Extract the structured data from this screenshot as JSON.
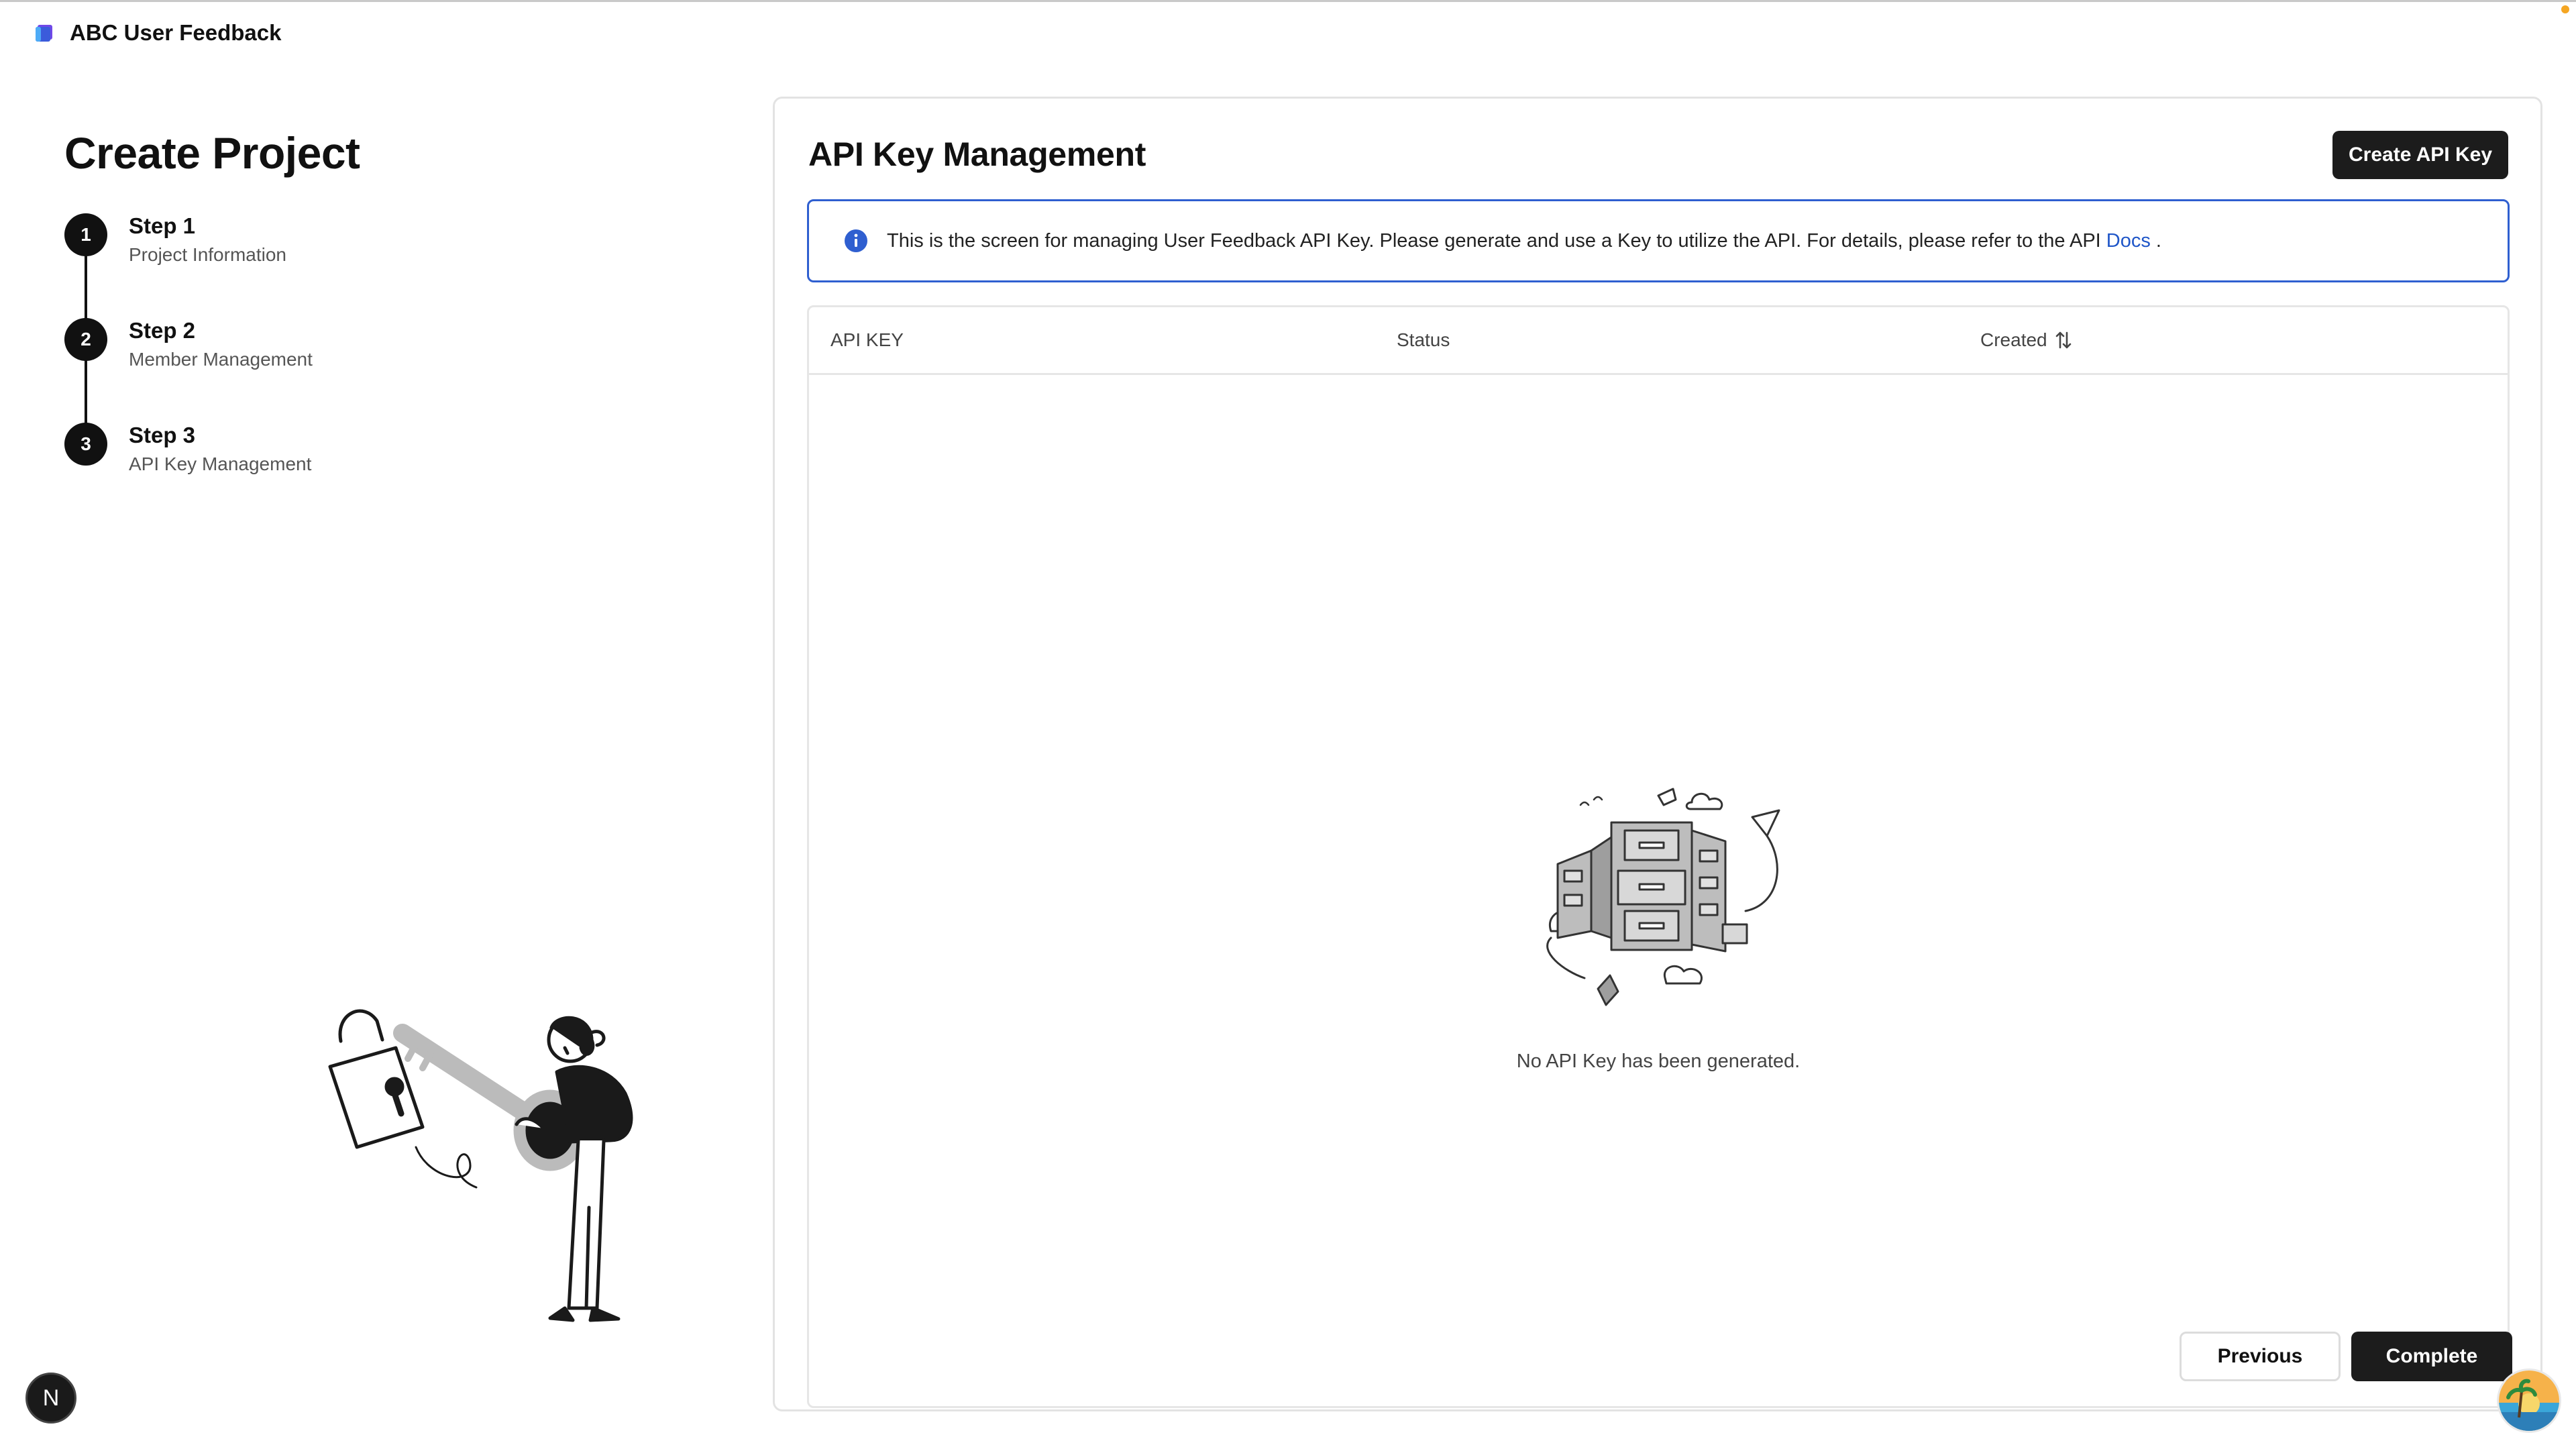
{
  "app": {
    "title": "ABC User Feedback"
  },
  "sidebar": {
    "page_title": "Create Project",
    "steps": [
      {
        "number": "1",
        "title": "Step 1",
        "subtitle": "Project Information"
      },
      {
        "number": "2",
        "title": "Step 2",
        "subtitle": "Member Management"
      },
      {
        "number": "3",
        "title": "Step 3",
        "subtitle": "API Key Management"
      }
    ]
  },
  "main": {
    "title": "API Key Management",
    "create_button": "Create API Key",
    "info": {
      "text": "This is the screen for managing User Feedback API Key. Please generate and use a Key to utilize the API. For details, please refer to the API",
      "link": "Docs",
      "suffix": "."
    },
    "table": {
      "columns": [
        "API KEY",
        "Status",
        "Created"
      ],
      "rows": [],
      "empty_text": "No API Key has been generated."
    },
    "previous_button": "Previous",
    "complete_button": "Complete"
  },
  "badge": {
    "label": "N"
  },
  "colors": {
    "accent_dark": "#1c1c1c",
    "info_border": "#2f5fd0",
    "link": "#1f56c8",
    "logo_blue": "#3b5bdb",
    "logo_purple": "#7048e8"
  },
  "icons": [
    "app-logo-icon",
    "info-icon",
    "sort-icon",
    "empty-archive-illustration",
    "lock-key-illustration"
  ]
}
